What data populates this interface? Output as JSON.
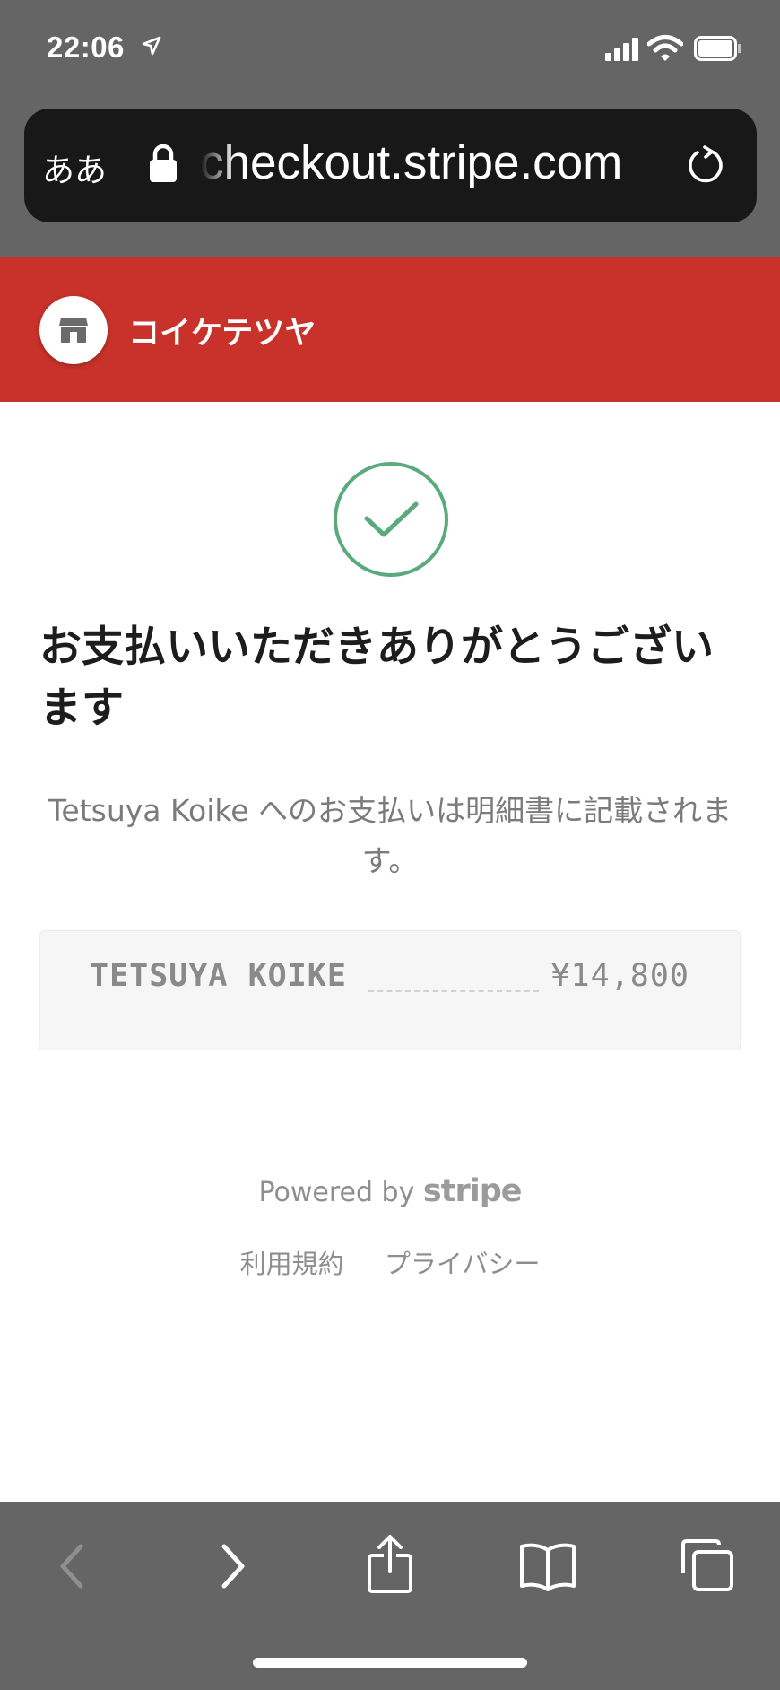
{
  "status_bar": {
    "time": "22:06",
    "icons": [
      "location-arrow-icon",
      "cellular-signal-icon",
      "wifi-icon",
      "battery-icon"
    ]
  },
  "browser": {
    "text_size_label": "ああ",
    "url": "checkout.stripe.com",
    "icons": [
      "lock-icon",
      "reload-icon"
    ]
  },
  "merchant": {
    "name": "コイケテツヤ",
    "logo_icon": "store-icon",
    "brand_color": "#c8322a"
  },
  "confirmation": {
    "status_icon": "checkmark-circle-icon",
    "success_color": "#5aaa7e",
    "heading": "お支払いいただきありがとうございます",
    "message": "Tetsuya Koike へのお支払いは明細書に記載されます。"
  },
  "receipt": {
    "descriptor": "TETSUYA KOIKE",
    "amount": "¥14,800"
  },
  "footer": {
    "powered_by": "Powered by",
    "brand": "stripe",
    "terms": "利用規約",
    "privacy": "プライバシー"
  },
  "toolbar": {
    "icons": [
      "back-icon",
      "forward-icon",
      "share-icon",
      "bookmarks-icon",
      "tabs-icon"
    ]
  }
}
